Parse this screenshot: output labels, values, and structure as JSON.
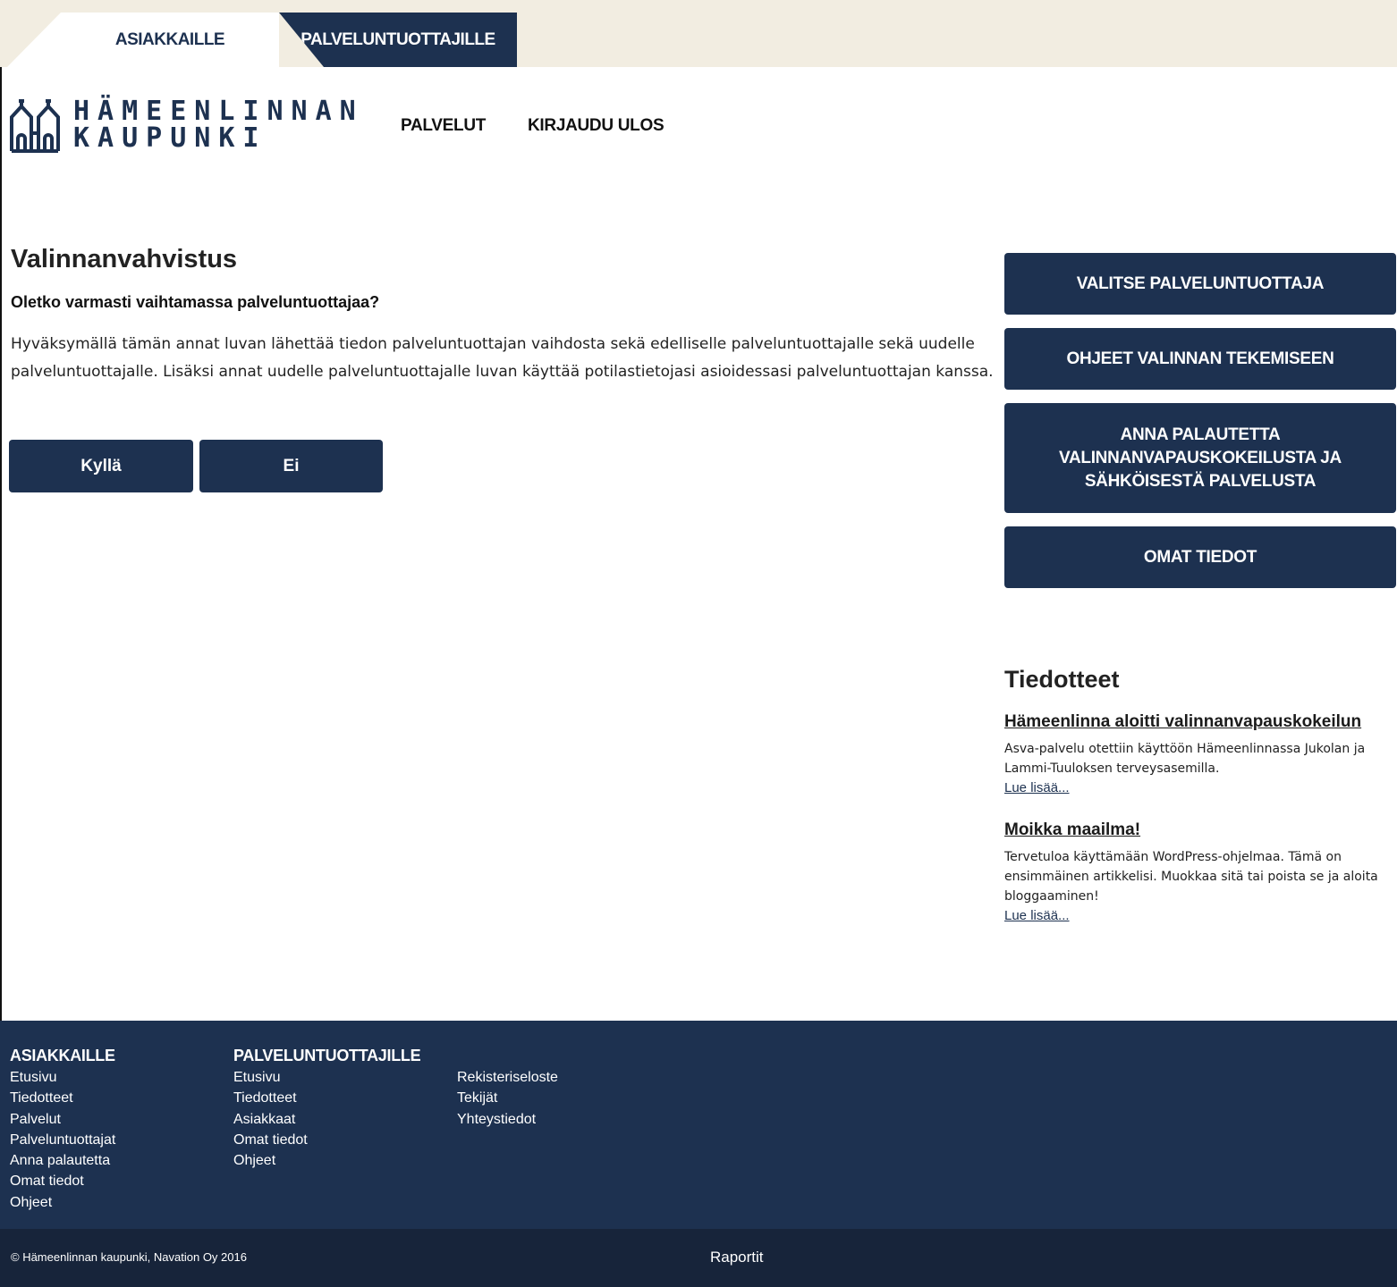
{
  "tabs": [
    {
      "label": "ASIAKKAILLE",
      "active": true
    },
    {
      "label": "PALVELUNTUOTTAJILLE",
      "active": false
    }
  ],
  "header": {
    "logo_line1": "HÄMEENLINNAN",
    "logo_line2": "KAUPUNKI",
    "nav": [
      "PALVELUT",
      "KIRJAUDU ULOS"
    ]
  },
  "main": {
    "title": "Valinnanvahvistus",
    "question": "Oletko varmasti vaihtamassa palveluntuottajaa?",
    "body": "Hyväksymällä tämän annat luvan lähettää tiedon palveluntuottajan vaihdosta sekä edelliselle palveluntuottajalle sekä uudelle palveluntuottajalle. Lisäksi annat uudelle palveluntuottajalle luvan käyttää potilastietojasi asioidessasi palveluntuottajan kanssa.",
    "yes_label": "Kyllä",
    "no_label": "Ei"
  },
  "sidebar": {
    "buttons": [
      "VALITSE PALVELUNTUOTTAJA",
      "OHJEET VALINNAN TEKEMISEEN",
      "ANNA PALAUTETTA VALINNANVAPAUSKOKEILUSTA JA SÄHKÖISESTÄ PALVELUSTA",
      "OMAT TIEDOT"
    ],
    "news_title": "Tiedotteet",
    "news": [
      {
        "headline": "Hämeenlinna aloitti valinnanvapauskokeilun",
        "excerpt": "Asva-palvelu otettiin käyttöön Hämeenlinnassa Jukolan ja Lammi-Tuuloksen terveysasemilla.",
        "more": "Lue lisää..."
      },
      {
        "headline": "Moikka maailma!",
        "excerpt": "Tervetuloa käyttämään WordPress-ohjelmaa. Tämä on ensimmäinen artikkelisi. Muokkaa sitä tai poista se ja aloita bloggaaminen!",
        "more": "Lue lisää..."
      }
    ]
  },
  "footer": {
    "col1_title": "ASIAKKAILLE",
    "col1_links": [
      "Etusivu",
      "Tiedotteet",
      "Palvelut",
      "Palveluntuottajat",
      "Anna palautetta",
      "Omat tiedot",
      "Ohjeet"
    ],
    "col2_title": "PALVELUNTUOTTAJILLE",
    "col2_links": [
      "Etusivu",
      "Tiedotteet",
      "Asiakkaat",
      "Omat tiedot",
      "Ohjeet"
    ],
    "col3_links": [
      "Rekisteriseloste",
      "Tekijät",
      "Yhteystiedot"
    ],
    "copyright": "© Hämeenlinnan kaupunki, Navation Oy 2016",
    "reports": "Raportit"
  },
  "colors": {
    "navy": "#1d3150",
    "dark_navy": "#17243a",
    "tab_bar": "#f2ede1"
  }
}
